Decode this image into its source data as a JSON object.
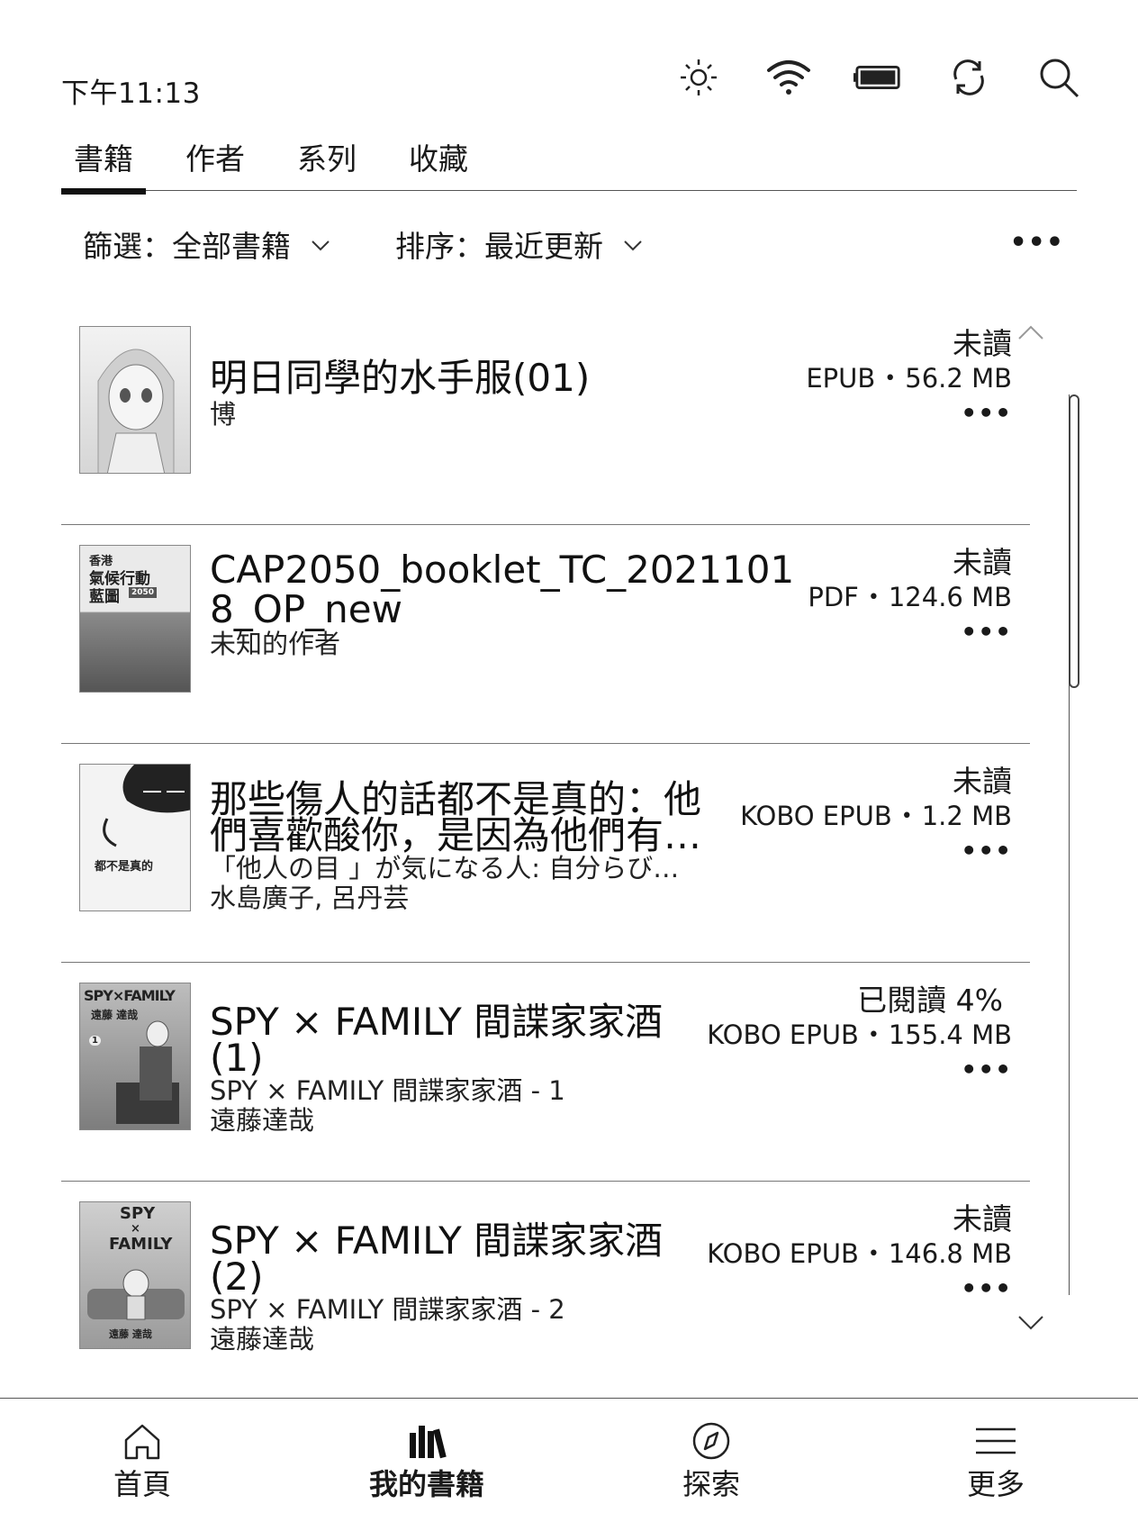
{
  "status_bar": {
    "time": "下午11:13",
    "icons": [
      "brightness-icon",
      "wifi-icon",
      "battery-icon",
      "sync-icon",
      "search-icon"
    ]
  },
  "tabs": [
    {
      "label": "書籍",
      "active": true
    },
    {
      "label": "作者",
      "active": false
    },
    {
      "label": "系列",
      "active": false
    },
    {
      "label": "收藏",
      "active": false
    }
  ],
  "filters": {
    "filter_label": "篩選：全部書籍",
    "sort_label": "排序：最近更新",
    "more": "•••"
  },
  "books": [
    {
      "title": "明日同學的水手服(01)",
      "lines": [
        "博"
      ],
      "status": "未讀",
      "format": "EPUB",
      "size": "56.2 MB",
      "cover": "cover-image-akebi"
    },
    {
      "title": "CAP2050_booklet_TC_2021101\n8_OP_new",
      "lines": [
        "未知的作者"
      ],
      "status": "未讀",
      "format": "PDF",
      "size": "124.6 MB",
      "cover": "cover-image-cap2050",
      "cover_text": [
        "香港",
        "氣候行動",
        "藍圖",
        "2050"
      ]
    },
    {
      "title": "那些傷人的話都不是真的：他\n們喜歡酸你，是因為他們有…",
      "lines": [
        "「他人の目 」が気になる人: 自分らび…",
        "水島廣子, 呂丹芸"
      ],
      "status": "未讀",
      "format": "KOBO EPUB",
      "size": "1.2 MB",
      "cover": "cover-image-words",
      "cover_text": [
        "都不是真的"
      ]
    },
    {
      "title": "SPY × FAMILY 間諜家家酒\n(1)",
      "lines": [
        "SPY × FAMILY 間諜家家酒 - 1",
        "遠藤達哉"
      ],
      "status": "已閱讀 4%",
      "format": "KOBO EPUB",
      "size": "155.4 MB",
      "cover": "cover-image-spy1",
      "cover_text": [
        "SPY×FAMILY",
        "遠藤 達哉",
        "1"
      ]
    },
    {
      "title": "SPY × FAMILY 間諜家家酒\n(2)",
      "lines": [
        "SPY × FAMILY 間諜家家酒 - 2",
        "遠藤達哉"
      ],
      "status": "未讀",
      "format": "KOBO EPUB",
      "size": "146.8 MB",
      "cover": "cover-image-spy2",
      "cover_text": [
        "SPY",
        "×",
        "FAMILY",
        "遠藤 達哉"
      ]
    }
  ],
  "bottom_nav": [
    {
      "label": "首頁",
      "icon": "home-icon",
      "active": false
    },
    {
      "label": "我的書籍",
      "icon": "library-icon",
      "active": true
    },
    {
      "label": "探索",
      "icon": "compass-icon",
      "active": false
    },
    {
      "label": "更多",
      "icon": "menu-icon",
      "active": false
    }
  ]
}
